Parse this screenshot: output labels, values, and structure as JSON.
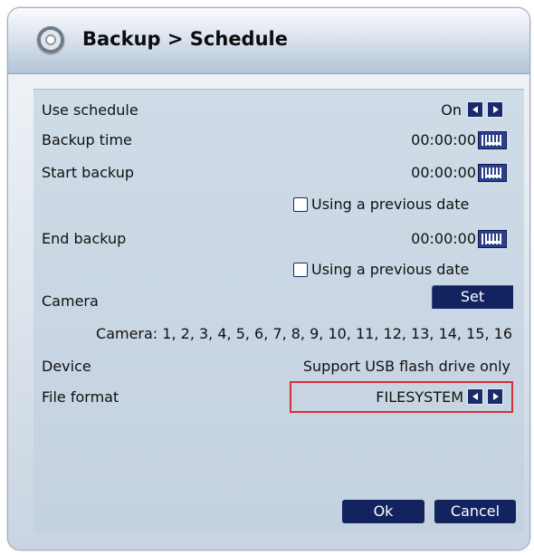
{
  "dialog": {
    "title": "Backup > Schedule"
  },
  "rows": {
    "use_schedule": {
      "label": "Use schedule",
      "value": "On"
    },
    "backup_time": {
      "label": "Backup time",
      "value": "00:00:00"
    },
    "start_backup": {
      "label": "Start backup",
      "value": "00:00:00",
      "checkbox_label": "Using a previous date"
    },
    "end_backup": {
      "label": "End backup",
      "value": "00:00:00",
      "checkbox_label": "Using a previous date"
    },
    "camera": {
      "label": "Camera",
      "button_label": "Set",
      "list_text": "Camera: 1, 2, 3, 4, 5, 6, 7, 8, 9, 10, 11, 12, 13, 14, 15, 16"
    },
    "device": {
      "label": "Device",
      "value": "Support USB flash drive only"
    },
    "file_format": {
      "label": "File format",
      "value": "FILESYSTEM"
    }
  },
  "footer": {
    "ok_label": "Ok",
    "cancel_label": "Cancel"
  },
  "colors": {
    "button_bg": "#13235f",
    "highlight_border": "#d32f3a",
    "panel_bg": "#cfdbe7"
  },
  "icons": {
    "title": "disc-icon",
    "keyboard": "keyboard-icon",
    "arrow_left": "arrow-left-icon",
    "arrow_right": "arrow-right-icon"
  }
}
